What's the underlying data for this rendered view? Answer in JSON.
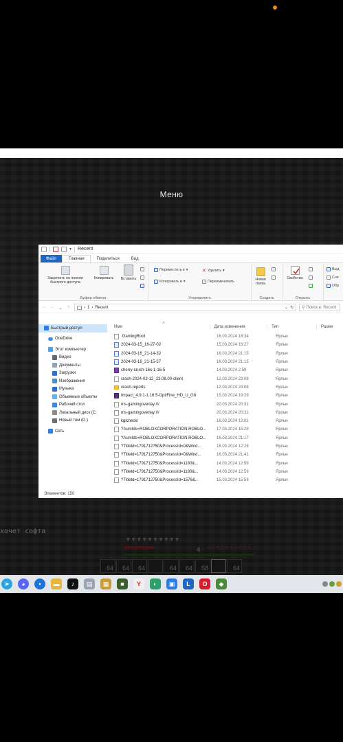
{
  "colors": {
    "accent": "#1f66c1",
    "selection": "#cce5fb",
    "taskbar": "#e3e6ea",
    "indicator": "#e8900c"
  },
  "game": {
    "menu_title": "Меню",
    "chat_line": "хочет софта",
    "level": "4",
    "hotbar_counts": [
      "64",
      "64",
      "64",
      "",
      "64",
      "64",
      "58",
      "",
      "64"
    ]
  },
  "window": {
    "title": "Recent",
    "ribbon_tabs": [
      "Файл",
      "Главная",
      "Поделиться",
      "Вид"
    ],
    "ribbon": {
      "clipboard": {
        "pin": "Закрепить на панели быстрого доступа",
        "copy": "Копировать",
        "paste": "Вставить",
        "group": "Буфер обмена"
      },
      "organize": {
        "move_to": "Переместить в",
        "copy_to": "Копировать в",
        "delete": "Удалить",
        "rename": "Переименовать",
        "group": "Упорядочить"
      },
      "new": {
        "new_folder": "Новая папка",
        "group": "Создать"
      },
      "open": {
        "properties": "Свойства",
        "group": "Открыть"
      },
      "select": {
        "item1": "Выд",
        "item2": "Сня",
        "item3": "Обр"
      }
    },
    "address": {
      "segment1": "1",
      "segment2": "Recent",
      "search_placeholder": "Поиск в: Recent"
    },
    "nav": [
      {
        "label": "Быстрый доступ",
        "icon": "star-icon"
      },
      {
        "label": "OneDrive",
        "icon": "cloud-icon"
      },
      {
        "label": "Этот компьютер",
        "icon": "computer-icon"
      },
      {
        "label": "Видео",
        "icon": "video-icon"
      },
      {
        "label": "Документы",
        "icon": "documents-icon"
      },
      {
        "label": "Загрузки",
        "icon": "download-icon"
      },
      {
        "label": "Изображения",
        "icon": "images-icon"
      },
      {
        "label": "Музыка",
        "icon": "music-icon"
      },
      {
        "label": "Объемные объекты",
        "icon": "3d-objects-icon"
      },
      {
        "label": "Рабочий стол",
        "icon": "desktop-icon"
      },
      {
        "label": "Локальный диск (C:",
        "icon": "disk-icon"
      },
      {
        "label": "Новый том (D:)",
        "icon": "drive-icon"
      },
      {
        "label": "Сеть",
        "icon": "network-icon"
      }
    ],
    "columns": {
      "name": "Имя",
      "date": "Дата изменения",
      "type": "Тип",
      "size": "Разме"
    },
    "files": [
      {
        "name": ".GamingRoot",
        "date": "16.03.2024 18:34",
        "type": "Ярлык",
        "icon": "file-icon"
      },
      {
        "name": "2024-03-15_16-27-02",
        "date": "15.03.2024 16:27",
        "type": "Ярлык",
        "icon": "screenshot-icon"
      },
      {
        "name": "2024-03-16_21-14-32",
        "date": "16.03.2024 21:15",
        "type": "Ярлык",
        "icon": "screenshot-icon"
      },
      {
        "name": "2024-03-16_21-15-27",
        "date": "16.03.2024 21:15",
        "type": "Ярлык",
        "icon": "screenshot-icon"
      },
      {
        "name": "cherry-crush-16x-1-16-5",
        "date": "14.03.2024 2:59",
        "type": "Ярлык",
        "icon": "resourcepack-icon"
      },
      {
        "name": "crash-2024-03-12_23.08.00-client",
        "date": "12.03.2024 23:08",
        "type": "Ярлык",
        "icon": "file-icon"
      },
      {
        "name": "crash-reports",
        "date": "12.03.2024 23:08",
        "type": "Ярлык",
        "icon": "folder-icon"
      },
      {
        "name": "Impact_4.9.1-1.16.5-OptiFine_HD_U_G8",
        "date": "15.03.2024 19:29",
        "type": "Ярлык",
        "icon": "archive-icon"
      },
      {
        "name": "ms-gamingoverlay:///",
        "date": "20.03.2024 20:31",
        "type": "Ярлык",
        "icon": "file-icon"
      },
      {
        "name": "ms-gamingoverlay:///",
        "date": "20.03.2024 20:31",
        "type": "Ярлык",
        "icon": "file-icon"
      },
      {
        "name": "kglcheck/",
        "date": "16.03.2024 12:01",
        "type": "Ярлык",
        "icon": "file-icon"
      },
      {
        "name": "?AumIds=ROBLOXCORPORATION.ROBLO...",
        "date": "17.03.2024 15:29",
        "type": "Ярлык",
        "icon": "file-icon"
      },
      {
        "name": "?AumIds=ROBLOXCORPORATION.ROBLO...",
        "date": "16.03.2024 21:17",
        "type": "Ярлык",
        "icon": "file-icon"
      },
      {
        "name": "?TitleId=1791712750&ProcessId=0&Wind...",
        "date": "18.03.2024 12:28",
        "type": "Ярлык",
        "icon": "file-icon"
      },
      {
        "name": "?TitleId=1791712750&ProcessId=0&Wind...",
        "date": "16.03.2024 21:41",
        "type": "Ярлык",
        "icon": "file-icon"
      },
      {
        "name": "?TitleId=1791712750&ProcessId=1180&...",
        "date": "14.03.2024 12:59",
        "type": "Ярлык",
        "icon": "file-icon"
      },
      {
        "name": "?TitleId=1791712750&ProcessId=1180&...",
        "date": "14.03.2024 12:59",
        "type": "Ярлык",
        "icon": "file-icon"
      },
      {
        "name": "?TitleId=1791712750&ProcessId=1576&...",
        "date": "15.03.2024 15:58",
        "type": "Ярлык",
        "icon": "file-icon"
      }
    ],
    "status": "Элементов: 150"
  },
  "taskbar": {
    "apps": [
      {
        "name": "telegram-app",
        "icon": "telegram-icon",
        "color": "#2aa3e0",
        "glyph": "➤"
      },
      {
        "name": "discord-app",
        "icon": "discord-icon",
        "color": "#5865f2",
        "glyph": "◕"
      },
      {
        "name": "messenger-app",
        "icon": "chat-icon",
        "color": "#1e74d6",
        "glyph": "▪"
      },
      {
        "name": "explorer-app",
        "icon": "folder-icon",
        "color": "#e8b63a",
        "glyph": "▬"
      },
      {
        "name": "tiktok-app",
        "icon": "tiktok-icon",
        "color": "#111111",
        "glyph": "♪"
      },
      {
        "name": "files-app",
        "icon": "document-icon",
        "color": "#9aa5b3",
        "glyph": "▤"
      },
      {
        "name": "photos-app",
        "icon": "image-icon",
        "color": "#c79a3a",
        "glyph": "▦"
      },
      {
        "name": "minecraft-app",
        "icon": "minecraft-icon",
        "color": "#3b5e2b",
        "glyph": "■"
      },
      {
        "name": "yandex-app",
        "icon": "yandex-icon",
        "color": "#f0f0f0",
        "glyph": "Y"
      },
      {
        "name": "edge-app",
        "icon": "edge-icon",
        "color": "#2c9f6c",
        "glyph": "◐"
      },
      {
        "name": "store-app",
        "icon": "store-icon",
        "color": "#2f7de1",
        "glyph": "▣"
      },
      {
        "name": "launcher-app",
        "icon": "launcher-icon",
        "color": "#1f66c1",
        "glyph": "L"
      },
      {
        "name": "opera-app",
        "icon": "opera-icon",
        "color": "#d81b2a",
        "glyph": "O"
      },
      {
        "name": "game-app",
        "icon": "cube-icon",
        "color": "#4a8a3a",
        "glyph": "◆"
      }
    ]
  }
}
